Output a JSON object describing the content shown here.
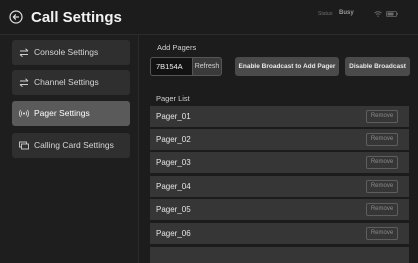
{
  "header": {
    "back_icon": "back-arrow-circle-icon",
    "title": "Call Settings",
    "status_label": "Status:",
    "status_value": "Busy",
    "wifi_icon": "wifi-icon",
    "battery_icon": "battery-icon"
  },
  "sidebar": {
    "items": [
      {
        "label": "Console Settings",
        "icon": "arrows-swap-icon",
        "active": false
      },
      {
        "label": "Channel Settings",
        "icon": "arrows-swap-icon",
        "active": false
      },
      {
        "label": "Pager Settings",
        "icon": "broadcast-signal-icon",
        "active": true
      },
      {
        "label": "Calling Card Settings",
        "icon": "cards-icon",
        "active": false
      }
    ]
  },
  "main": {
    "add_pagers_label": "Add Pagers",
    "pager_input_value": "7B154A",
    "refresh_label": "Refresh",
    "enable_broadcast_label": "Enable Broadcast to Add Pager",
    "disable_broadcast_label": "Disable Broadcast",
    "pager_list_label": "Pager List",
    "remove_label": "Remove",
    "pagers": [
      "Pager_01",
      "Pager_02",
      "Pager_03",
      "Pager_04",
      "Pager_05",
      "Pager_06"
    ]
  }
}
